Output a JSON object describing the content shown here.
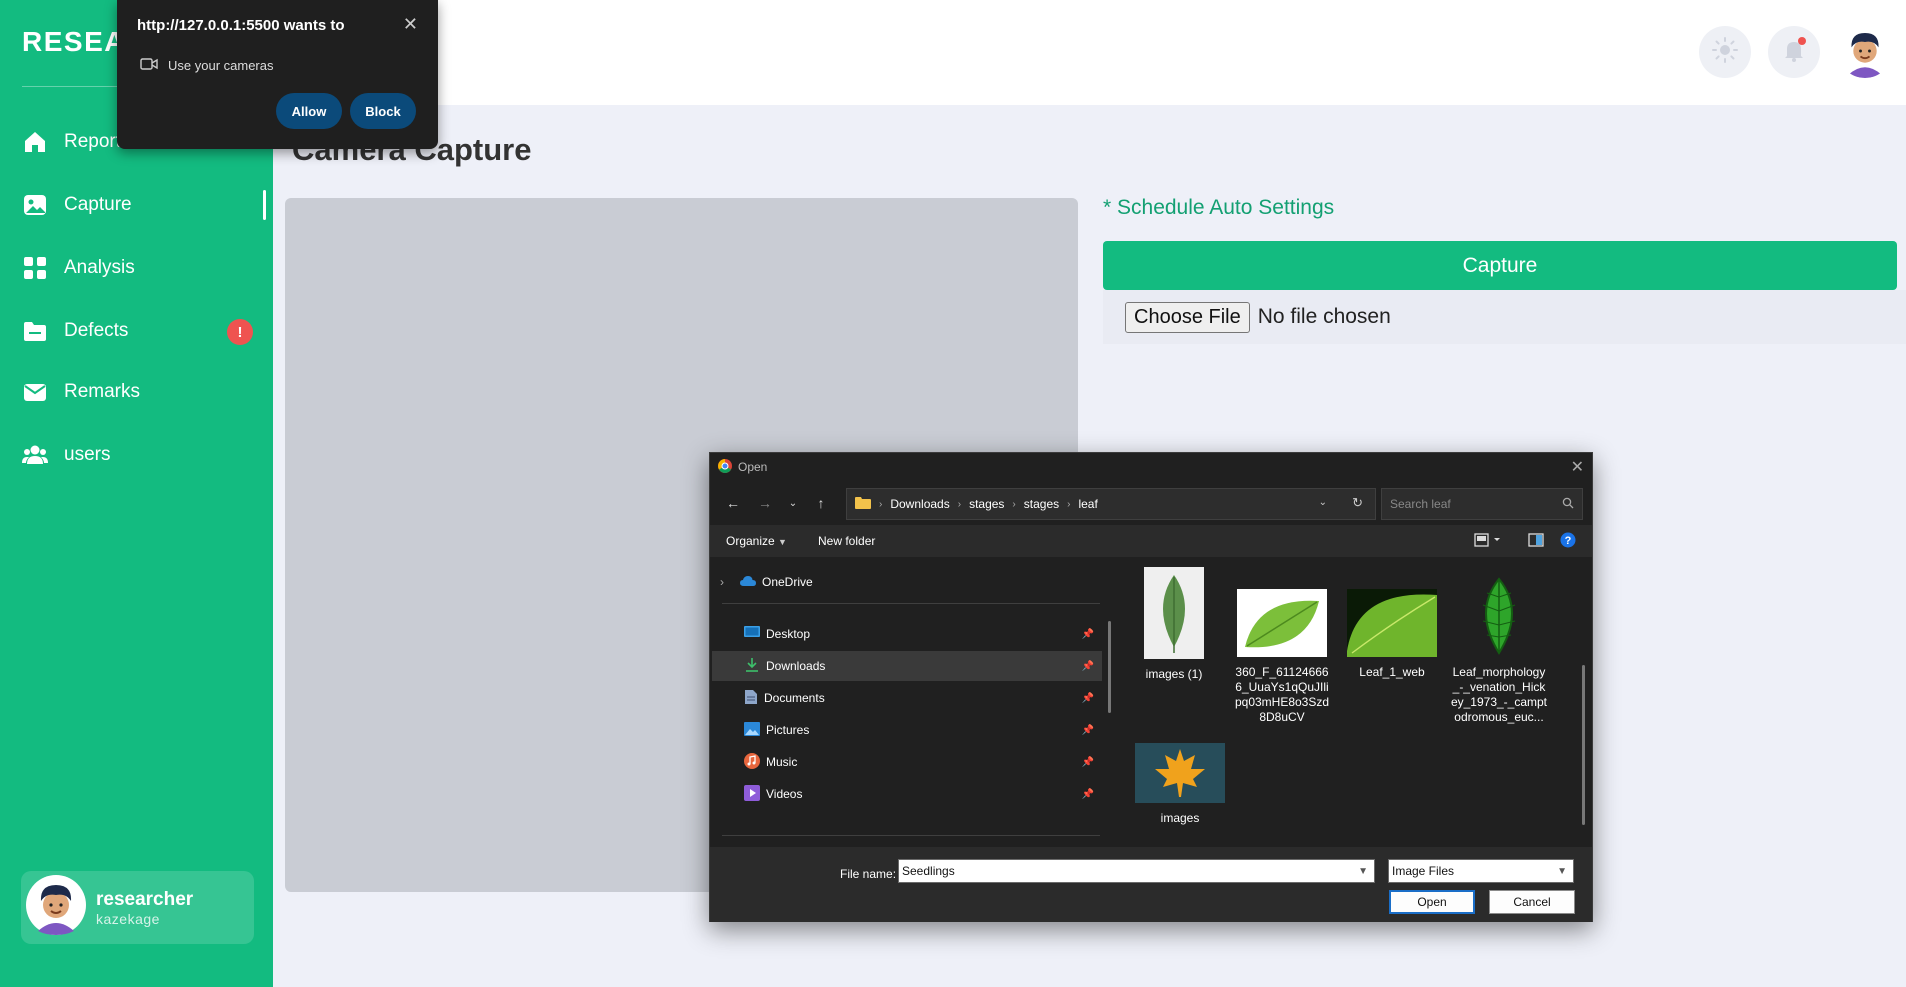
{
  "sidebar": {
    "brand": "RESEARCH",
    "items": [
      {
        "label": "Reports"
      },
      {
        "label": "Capture"
      },
      {
        "label": "Analysis"
      },
      {
        "label": "Defects",
        "badge": "!"
      },
      {
        "label": "Remarks"
      },
      {
        "label": "users"
      }
    ],
    "user": {
      "name": "researcher",
      "role": "kazekage"
    }
  },
  "main": {
    "title": "Camera Capture",
    "schedule_link": "* Schedule Auto Settings",
    "capture_label": "Capture",
    "choose_file_label": "Choose File",
    "file_status": "No file chosen"
  },
  "permission": {
    "title": "http://127.0.0.1:5500 wants to",
    "request": "Use your cameras",
    "allow_label": "Allow",
    "block_label": "Block",
    "close_glyph": "✕"
  },
  "dialog": {
    "title": "Open",
    "breadcrumb": [
      "Downloads",
      "stages",
      "stages",
      "leaf"
    ],
    "search_placeholder": "Search leaf",
    "organize_label": "Organize",
    "new_folder_label": "New folder",
    "nav_items": [
      {
        "label": "OneDrive",
        "icon": "cloud-icon"
      },
      {
        "label": "Desktop",
        "icon": "desktop-icon"
      },
      {
        "label": "Downloads",
        "icon": "download-icon",
        "selected": true
      },
      {
        "label": "Documents",
        "icon": "document-icon"
      },
      {
        "label": "Pictures",
        "icon": "pictures-icon"
      },
      {
        "label": "Music",
        "icon": "music-icon"
      },
      {
        "label": "Videos",
        "icon": "videos-icon"
      }
    ],
    "files": [
      {
        "name": "images (1)"
      },
      {
        "name": "360_F_611246666_UuaYs1qQuJIlipq03mHE8o3Szd8D8uCV"
      },
      {
        "name": "Leaf_1_web"
      },
      {
        "name": "Leaf_morphology_-_venation_Hickey_1973_-_camptodromous_euc..."
      },
      {
        "name": "images"
      }
    ],
    "file_name_label": "File name:",
    "file_name_value": "Seedlings",
    "file_type": "Image Files",
    "open_label": "Open",
    "cancel_label": "Cancel"
  },
  "colors": {
    "accent": "#13bb80",
    "alert": "#ef5350",
    "dialog_bg": "#202020",
    "permission_button": "#0b4a7a"
  }
}
